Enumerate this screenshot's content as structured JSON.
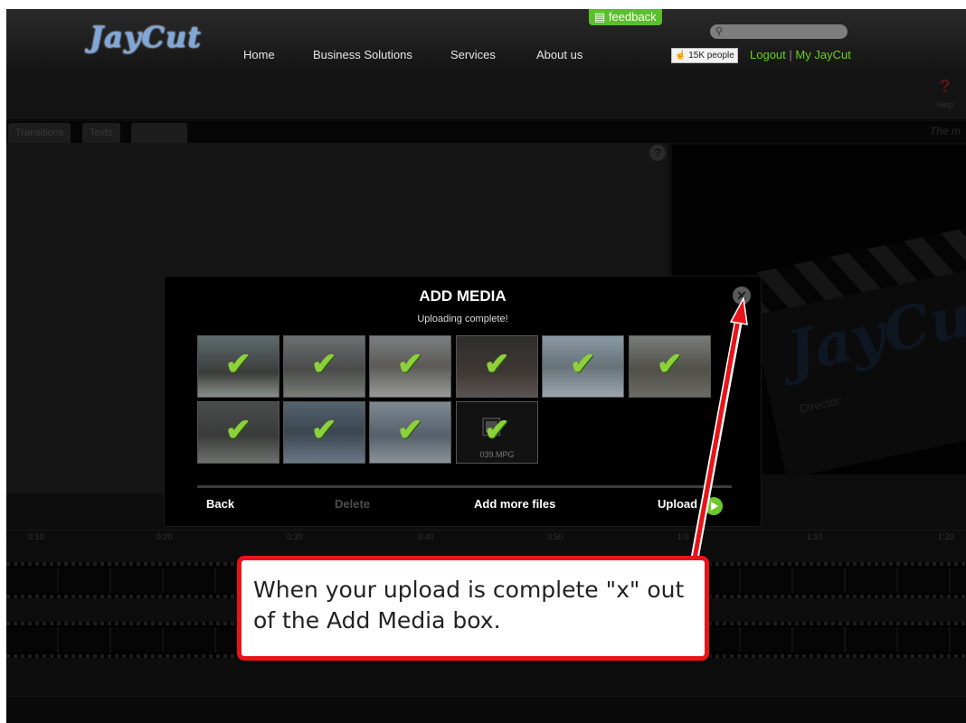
{
  "header": {
    "logo": "JayCut",
    "nav": [
      "Home",
      "Business Solutions",
      "Services",
      "About us"
    ],
    "feedback": "feedback",
    "like_count": "15K people",
    "logout": "Logout",
    "sep": "|",
    "my_account": "My JayCut",
    "help_label": "Help"
  },
  "editor": {
    "tabs": [
      "Transitions",
      "Texts",
      ""
    ],
    "right_tab_label": "The m",
    "timeline_ticks": [
      "0:10",
      "0:20",
      "0:30",
      "0:40",
      "0:50",
      "1:0",
      "1:10",
      "1:20"
    ],
    "preview_clap_logo": "JayCut",
    "preview_clap_director": "Director:"
  },
  "modal": {
    "title": "ADD MEDIA",
    "subtitle": "Uploading complete!",
    "thumbnails": [
      {
        "file": ""
      },
      {
        "file": ""
      },
      {
        "file": ""
      },
      {
        "file": ""
      },
      {
        "file": ""
      },
      {
        "file": ""
      },
      {
        "file": ""
      },
      {
        "file": ""
      },
      {
        "file": ""
      },
      {
        "file": "039.MPG"
      }
    ],
    "buttons": {
      "back": "Back",
      "delete": "Delete",
      "add_more": "Add more files",
      "upload": "Upload"
    }
  },
  "annotation": {
    "text": "When your upload is complete \"x\" out of the Add Media box."
  },
  "colors": {
    "accent_green": "#6ccf1e",
    "annotation_red": "#e8141a"
  }
}
